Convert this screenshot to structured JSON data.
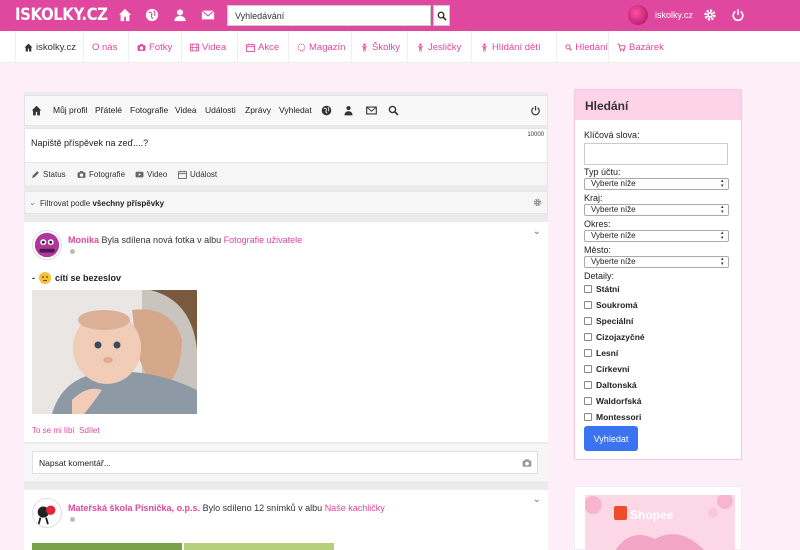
{
  "topbar": {
    "logo": "ISKOLKY.CZ",
    "search_placeholder": "Vyhledávání",
    "username": "iskolky.cz"
  },
  "nav": {
    "items": [
      "iskolky.cz",
      "O nás",
      "Fotky",
      "Videa",
      "Akce",
      "Magazín",
      "Školky",
      "Jesličky",
      "Hlídání dětí",
      "Hledání",
      "Bazárek"
    ]
  },
  "subnav": {
    "items": [
      "Můj profil",
      "Přátelé",
      "Fotografie",
      "Videa",
      "Události",
      "Zprávy",
      "Vyhledat"
    ]
  },
  "composer": {
    "counter": "10000",
    "placeholder": "Napiště příspěvek na zeď....?",
    "actions": [
      "Status",
      "Fotografie",
      "Video",
      "Událost"
    ]
  },
  "filter": {
    "prefix": "Filtrovat podle",
    "value": "všechny příspěvky"
  },
  "post1": {
    "author": "Monika",
    "text": "Byla sdílena nová fotka v albu",
    "album": "Fotografie uživatele",
    "feeling_prefix": "-",
    "feeling": "cítí se bezeslov",
    "like": "To se mi líbí",
    "share": "Sdílet",
    "comment_placeholder": "Napsat komentář..."
  },
  "post2": {
    "author": "Mateřská škola Písnička, o.p.s.",
    "text": "Bylo sdíleno 12 snímků v albu",
    "album": "Naše kachličky"
  },
  "sidebar": {
    "title": "Hledání",
    "keywords_label": "Klíčová slova:",
    "account_type_label": "Typ účtu:",
    "region_label": "Kraj:",
    "district_label": "Okres:",
    "city_label": "Město:",
    "select_default": "Vyberte níže",
    "details_label": "Detaily:",
    "details": [
      "Státní",
      "Soukromá",
      "Speciální",
      "Cizojazyčné",
      "Lesní",
      "Církevní",
      "Daltonská",
      "Waldorfská",
      "Montessori"
    ],
    "search_button": "Vyhledat"
  },
  "ad": {
    "brand": "Shopee"
  },
  "colors": {
    "brand": "#e0479e",
    "button": "#3b73f0"
  }
}
